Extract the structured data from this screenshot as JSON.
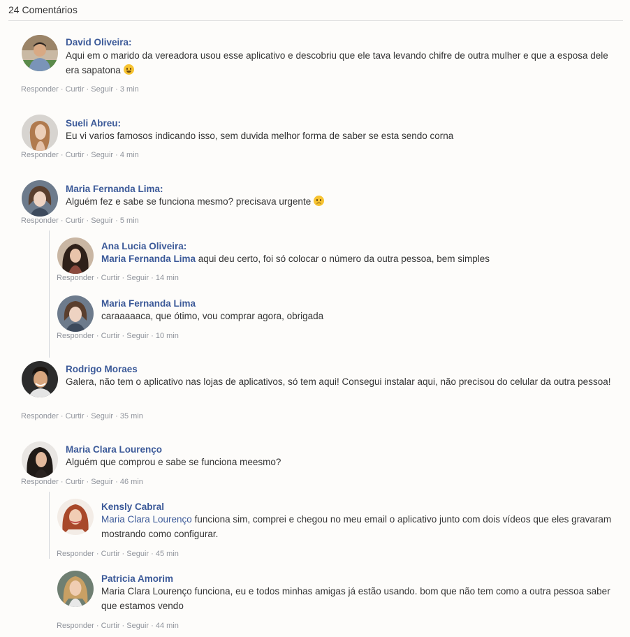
{
  "header": {
    "title": "24 Comentários"
  },
  "actions": {
    "reply": "Responder",
    "like": "Curtir",
    "follow": "Seguir",
    "sep": " · "
  },
  "comments": [
    {
      "name": "David Oliveira:",
      "text": "Aqui em o marido da vereadora usou esse aplicativo e descobriu que ele tava levando chifre de outra mulher e que a esposa dele era sapatona",
      "emoji": "laugh-tears-icon",
      "time": "3 min"
    },
    {
      "name": "Sueli Abreu:",
      "text": "Eu vi varios famosos indicando isso, sem duvida melhor forma de saber se esta sendo corna",
      "time": "4 min"
    },
    {
      "name": "Maria Fernanda Lima:",
      "text": "Alguém fez e sabe se funciona mesmo? precisava urgente",
      "emoji": "sad-face-icon",
      "time": "5 min"
    },
    {
      "name": "Ana Lucia Oliveira:",
      "mention": "Maria Fernanda Lima",
      "text": " aqui deu certo, foi só colocar o número da outra pessoa, bem simples",
      "time": "14 min"
    },
    {
      "name": "Maria Fernanda Lima",
      "text": "caraaaaaca, que ótimo, vou comprar agora, obrigada",
      "time": "10 min"
    },
    {
      "name": "Rodrigo Moraes",
      "text": "Galera, não tem o aplicativo nas lojas de aplicativos, só tem aqui! Consegui instalar aqui, não precisou do celular da outra pessoa!",
      "time": "35 min"
    },
    {
      "name": "Maria Clara Lourenço",
      "text": "Alguém que comprou e sabe se funciona meesmo?",
      "time": "46 min"
    },
    {
      "name": "Kensly Cabral",
      "mention": "Maria Clara Lourenço",
      "text": " funciona sim, comprei e chegou no meu email o aplicativo junto com dois vídeos que eles gravaram mostrando como configurar.",
      "time": "45 min"
    },
    {
      "name": "Patricia Amorim",
      "text": "Maria Clara Lourenço funciona, eu e todos minhas amigas já estão usando. bom que não tem como a outra pessoa saber que estamos vendo",
      "time": "44 min"
    }
  ],
  "colors": {
    "name_blue": "#3b5998",
    "meta_gray": "#90949c",
    "background": "#fdfcfa"
  }
}
